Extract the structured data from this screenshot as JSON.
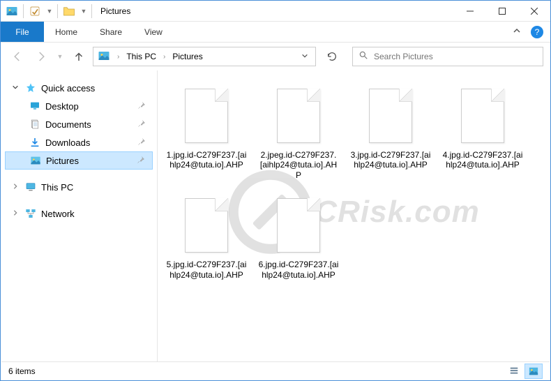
{
  "window": {
    "title": "Pictures"
  },
  "ribbon": {
    "file": "File",
    "tabs": [
      "Home",
      "Share",
      "View"
    ]
  },
  "breadcrumb": {
    "root": "This PC",
    "current": "Pictures"
  },
  "search": {
    "placeholder": "Search Pictures"
  },
  "sidebar": {
    "quick_access": "Quick access",
    "items": [
      {
        "label": "Desktop",
        "icon": "desktop"
      },
      {
        "label": "Documents",
        "icon": "documents"
      },
      {
        "label": "Downloads",
        "icon": "downloads"
      },
      {
        "label": "Pictures",
        "icon": "pictures",
        "selected": true
      }
    ],
    "this_pc": "This PC",
    "network": "Network"
  },
  "files": [
    {
      "name": "1.jpg.id-C279F237.[aihlp24@tuta.io].AHP"
    },
    {
      "name": "2.jpeg.id-C279F237.[aihlp24@tuta.io].AHP"
    },
    {
      "name": "3.jpg.id-C279F237.[aihlp24@tuta.io].AHP"
    },
    {
      "name": "4.jpg.id-C279F237.[aihlp24@tuta.io].AHP"
    },
    {
      "name": "5.jpg.id-C279F237.[aihlp24@tuta.io].AHP"
    },
    {
      "name": "6.jpg.id-C279F237.[aihlp24@tuta.io].AHP"
    }
  ],
  "status": {
    "count": "6 items"
  },
  "watermark": {
    "text": "CRisk.com"
  }
}
